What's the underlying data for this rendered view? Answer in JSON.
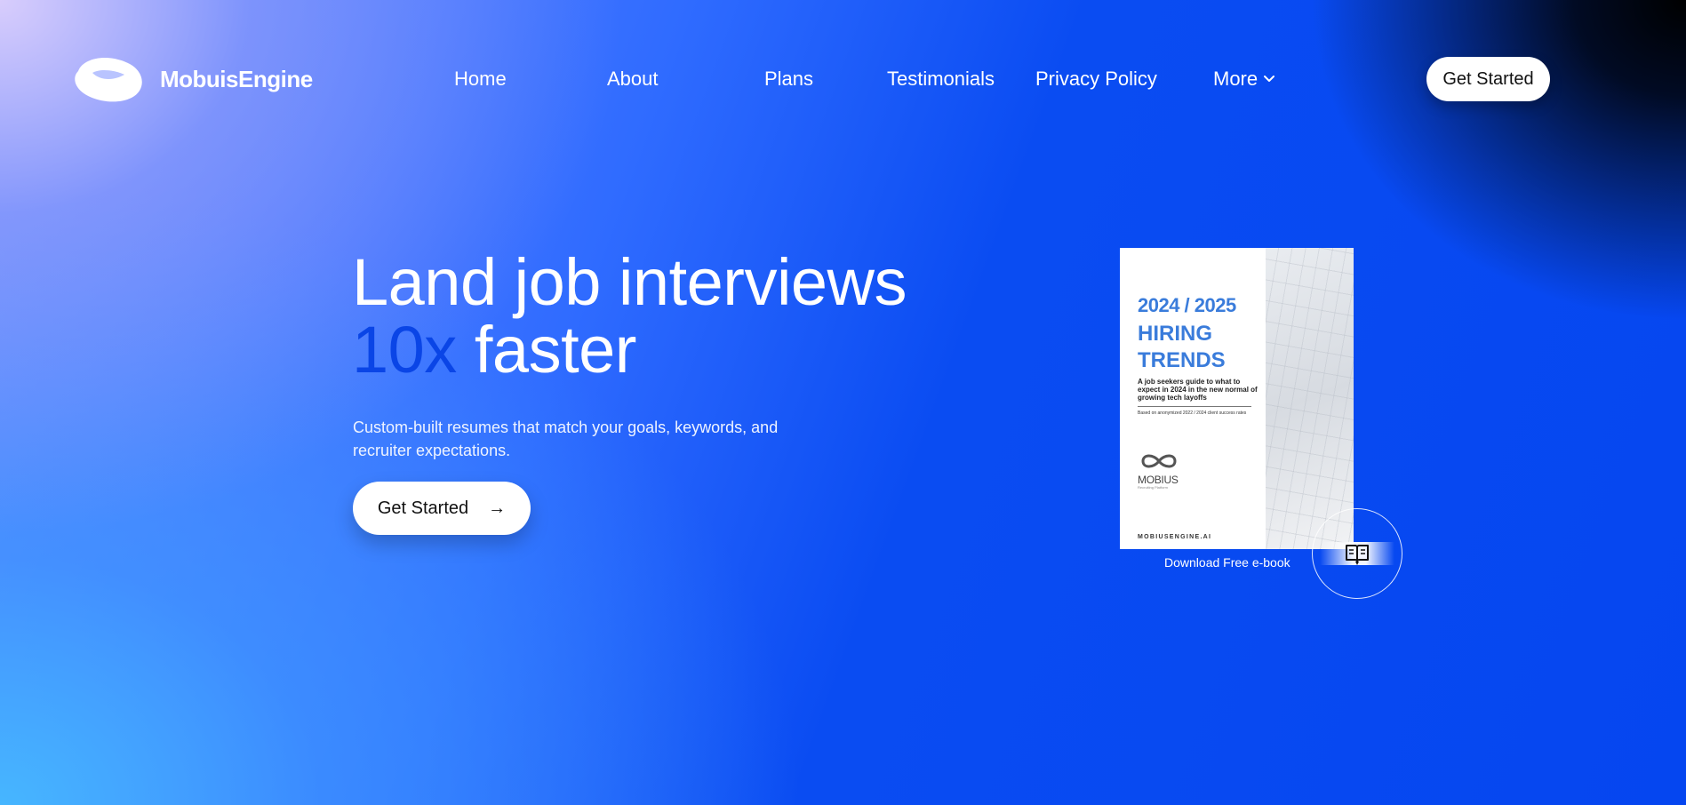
{
  "brand": {
    "name": "MobuisEngine",
    "logo_icon": "logo-mark-icon"
  },
  "nav": {
    "items": [
      {
        "label": "Home"
      },
      {
        "label": "About"
      },
      {
        "label": "Plans"
      },
      {
        "label": "Testimonials"
      },
      {
        "label": "Privacy Policy"
      },
      {
        "label": "More",
        "icon": "chevron-down-icon"
      }
    ],
    "cta_label": "Get Started"
  },
  "hero": {
    "title_line1": "Land job interviews",
    "title_accent": "10x",
    "title_rest": " faster",
    "subtitle": "Custom-built resumes that match your goals, keywords, and recruiter expectations.",
    "cta_label": "Get Started",
    "cta_arrow": "→"
  },
  "ebook": {
    "year": "2024 / 2025",
    "title": "HIRING TRENDS",
    "description": "A job seekers guide to what to expect in 2024 in the new normal of growing tech layoffs",
    "note": "Based on anonymized 2022 / 2024 client success rates",
    "logo_name": "MOBIUS",
    "logo_sub": "Recruiting Platform",
    "site": "MOBIUSENGINE.AI",
    "download_label": "Download Free e-book",
    "icon": "open-book-icon"
  },
  "colors": {
    "accent": "#0a45e6",
    "ebook_blue": "#3a7cdb",
    "white": "#ffffff"
  }
}
